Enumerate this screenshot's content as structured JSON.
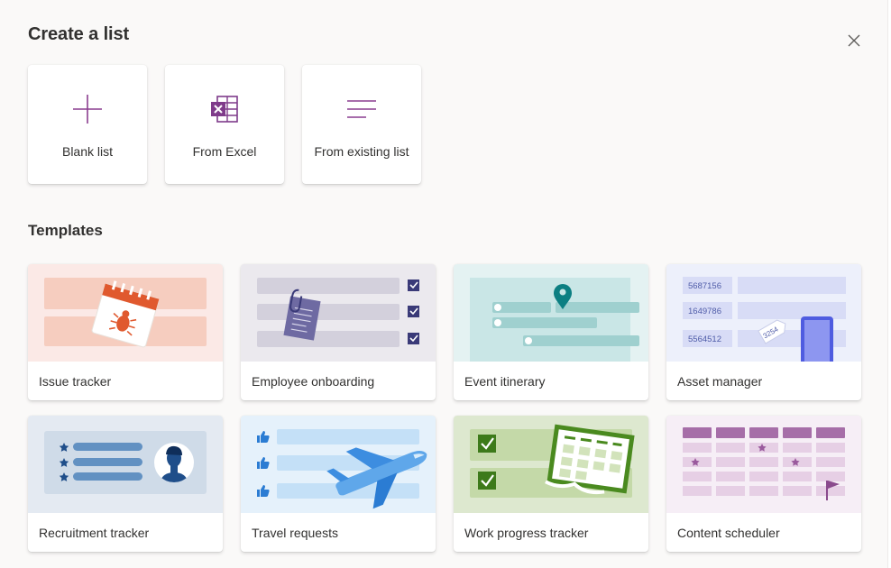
{
  "dialog": {
    "title": "Create a list",
    "close_icon": "close-icon"
  },
  "create_options": [
    {
      "label": "Blank list",
      "icon": "plus-icon"
    },
    {
      "label": "From Excel",
      "icon": "excel-icon"
    },
    {
      "label": "From existing list",
      "icon": "list-lines-icon"
    }
  ],
  "templates_section": {
    "title": "Templates",
    "items": [
      {
        "label": "Issue tracker"
      },
      {
        "label": "Employee onboarding"
      },
      {
        "label": "Event itinerary"
      },
      {
        "label": "Asset manager",
        "art_text": [
          "5687156",
          "1649786",
          "5564512",
          "3254"
        ]
      },
      {
        "label": "Recruitment tracker"
      },
      {
        "label": "Travel requests"
      },
      {
        "label": "Work progress tracker"
      },
      {
        "label": "Content scheduler"
      }
    ]
  },
  "colors": {
    "accent": "#8a3d8f",
    "excel_purple": "#7f3b8a",
    "background": "#faf9f8"
  }
}
